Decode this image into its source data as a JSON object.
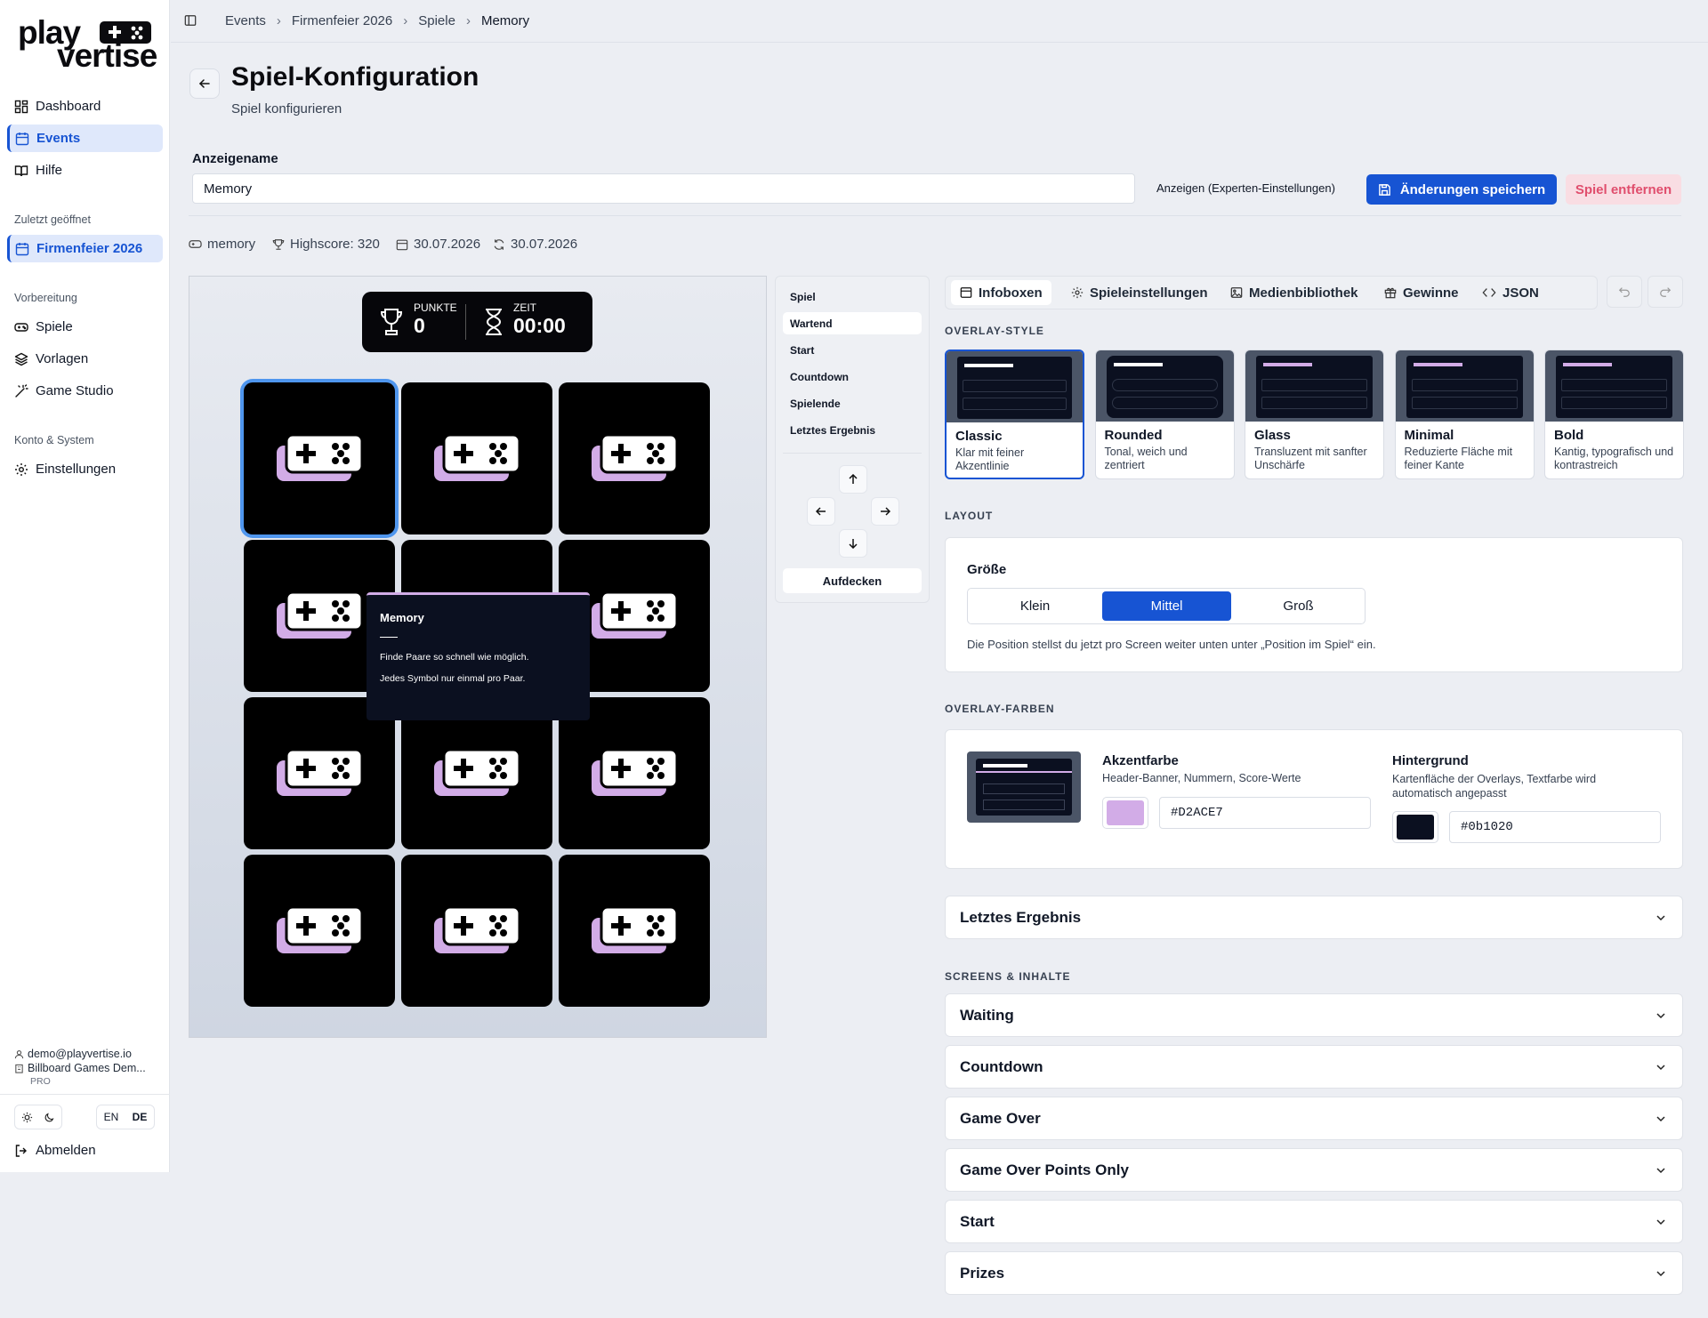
{
  "brand": {
    "logo_line1": "play",
    "logo_line2": "vertise"
  },
  "sidebar": {
    "nav": [
      {
        "label": "Dashboard",
        "icon": "dashboard-icon"
      },
      {
        "label": "Events",
        "icon": "calendar-icon"
      },
      {
        "label": "Hilfe",
        "icon": "book-icon"
      }
    ],
    "recent_heading": "Zuletzt geöffnet",
    "recent_item": "Firmenfeier 2026",
    "prep_heading": "Vorbereitung",
    "prep": [
      {
        "label": "Spiele",
        "icon": "gamepad-icon"
      },
      {
        "label": "Vorlagen",
        "icon": "layers-icon"
      },
      {
        "label": "Game Studio",
        "icon": "magic-wand-icon"
      }
    ],
    "account_heading": "Konto & System",
    "account": [
      {
        "label": "Einstellungen",
        "icon": "gear-icon"
      }
    ],
    "user_email": "demo@playvertise.io",
    "org": "Billboard Games Dem...",
    "plan": "PRO",
    "lang_en": "EN",
    "lang_de": "DE",
    "logout": "Abmelden"
  },
  "breadcrumb": [
    "Events",
    "Firmenfeier 2026",
    "Spiele",
    "Memory"
  ],
  "header": {
    "title": "Spiel-Konfiguration",
    "subtitle": "Spiel konfigurieren"
  },
  "form": {
    "name_label": "Anzeigename",
    "name_value": "Memory",
    "expert_link": "Anzeigen (Experten-Einstellungen)",
    "save_label": "Änderungen speichern",
    "remove_label": "Spiel entfernen"
  },
  "meta": {
    "slug": "memory",
    "highscore": "Highscore: 320",
    "created": "30.07.2026",
    "updated": "30.07.2026"
  },
  "preview": {
    "hud": {
      "points_label": "PUNKTE",
      "points_value": "0",
      "time_label": "ZEIT",
      "time_value": "00:00"
    },
    "tooltip": {
      "title": "Memory",
      "line1": "Finde Paare so schnell wie möglich.",
      "line2": "Jedes Symbol nur einmal pro Paar."
    }
  },
  "screens": {
    "items": [
      "Spiel",
      "Wartend",
      "Start",
      "Countdown",
      "Spielende",
      "Letztes Ergebnis"
    ],
    "active": "Wartend",
    "reveal": "Aufdecken"
  },
  "tabs": [
    {
      "label": "Infoboxen",
      "icon": "panel-icon"
    },
    {
      "label": "Spieleinstellungen",
      "icon": "gear-icon"
    },
    {
      "label": "Medienbibliothek",
      "icon": "image-icon"
    },
    {
      "label": "Gewinne",
      "icon": "gift-icon"
    },
    {
      "label": "JSON",
      "icon": "code-icon"
    }
  ],
  "overlay_style": {
    "heading": "OVERLAY-STYLE",
    "options": [
      {
        "name": "Classic",
        "desc": "Klar mit feiner Akzentlinie"
      },
      {
        "name": "Rounded",
        "desc": "Tonal, weich und zentriert"
      },
      {
        "name": "Glass",
        "desc": "Transluzent mit sanfter Unschärfe"
      },
      {
        "name": "Minimal",
        "desc": "Reduzierte Fläche mit feiner Kante"
      },
      {
        "name": "Bold",
        "desc": "Kantig, typografisch und kontrastreich"
      }
    ],
    "selected": "Classic"
  },
  "layout": {
    "heading": "LAYOUT",
    "size_label": "Größe",
    "sizes": [
      "Klein",
      "Mittel",
      "Groß"
    ],
    "selected": "Mittel",
    "hint": "Die Position stellst du jetzt pro Screen weiter unten unter „Position im Spiel“ ein."
  },
  "overlay_colors": {
    "heading": "OVERLAY-FARBEN",
    "accent_label": "Akzentfarbe",
    "accent_desc": "Header-Banner, Nummern, Score-Werte",
    "accent_value": "#D2ACE7",
    "bg_label": "Hintergrund",
    "bg_desc": "Kartenfläche der Overlays, Textfarbe wird automatisch angepasst",
    "bg_value": "#0b1020"
  },
  "last_result": "Letztes Ergebnis",
  "screens_section": {
    "heading": "SCREENS & INHALTE",
    "items": [
      "Waiting",
      "Countdown",
      "Game Over",
      "Game Over Points Only",
      "Start",
      "Prizes"
    ]
  },
  "colors": {
    "primary": "#1754d3",
    "accent": "#D2ACE7",
    "danger": "#e04e6d",
    "overlay_bg": "#0b1020"
  }
}
